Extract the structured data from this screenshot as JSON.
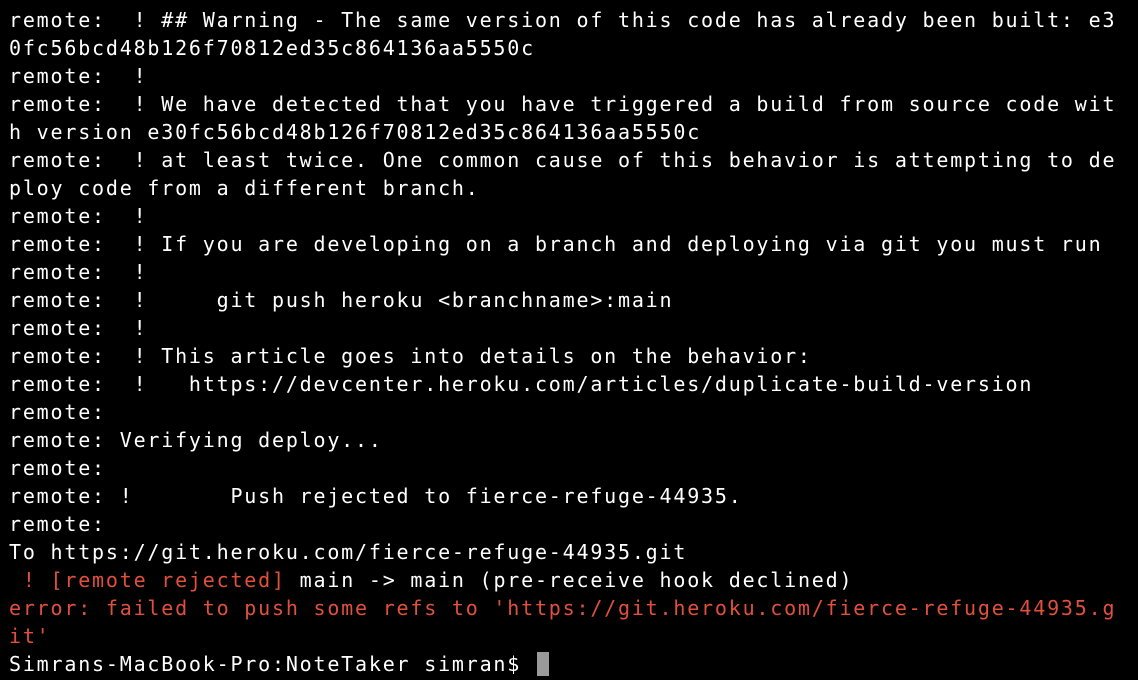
{
  "terminal": {
    "lines": [
      {
        "text": "remote:  ! ## Warning - The same version of this code has already been built: e3",
        "color": "#ffffff"
      },
      {
        "text": "0fc56bcd48b126f70812ed35c864136aa5550c",
        "color": "#ffffff"
      },
      {
        "text": "remote:  !",
        "color": "#ffffff"
      },
      {
        "text": "remote:  ! We have detected that you have triggered a build from source code wit",
        "color": "#ffffff"
      },
      {
        "text": "h version e30fc56bcd48b126f70812ed35c864136aa5550c",
        "color": "#ffffff"
      },
      {
        "text": "remote:  ! at least twice. One common cause of this behavior is attempting to de",
        "color": "#ffffff"
      },
      {
        "text": "ploy code from a different branch.",
        "color": "#ffffff"
      },
      {
        "text": "remote:  !",
        "color": "#ffffff"
      },
      {
        "text": "remote:  ! If you are developing on a branch and deploying via git you must run",
        "color": "#ffffff"
      },
      {
        "text": "remote:  !",
        "color": "#ffffff"
      },
      {
        "text": "remote:  !     git push heroku <branchname>:main",
        "color": "#ffffff"
      },
      {
        "text": "remote:  !",
        "color": "#ffffff"
      },
      {
        "text": "remote:  ! This article goes into details on the behavior:",
        "color": "#ffffff"
      },
      {
        "text": "remote:  !   https://devcenter.heroku.com/articles/duplicate-build-version",
        "color": "#ffffff"
      },
      {
        "text": "remote:",
        "color": "#ffffff"
      },
      {
        "text": "remote: Verifying deploy...",
        "color": "#ffffff"
      },
      {
        "text": "remote:",
        "color": "#ffffff"
      },
      {
        "text": "remote: !       Push rejected to fierce-refuge-44935.",
        "color": "#ffffff"
      },
      {
        "text": "remote:",
        "color": "#ffffff"
      },
      {
        "text": "To https://git.heroku.com/fierce-refuge-44935.git",
        "color": "#ffffff"
      }
    ],
    "rejected_line": {
      "prefix": " ! [remote rejected]",
      "rest": " main -> main (pre-receive hook declined)"
    },
    "error_lines": [
      "error: failed to push some refs to 'https://git.heroku.com/fierce-refuge-44935.g",
      "it'"
    ],
    "prompt": "Simrans-MacBook-Pro:NoteTaker simran$ "
  },
  "colors": {
    "background": "#000000",
    "text": "#ffffff",
    "error": "#e0503c",
    "cursor": "#9a9a9a"
  }
}
